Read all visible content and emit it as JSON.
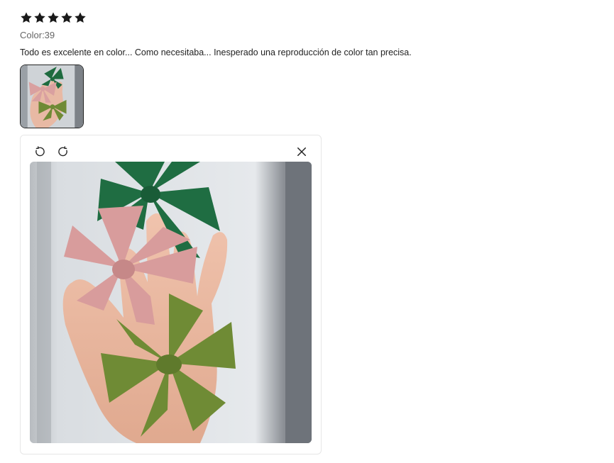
{
  "review": {
    "rating": 5,
    "rating_max": 5,
    "sku_info": "Color:39",
    "text": "Todo es excelente en color... Como necesitaba... Inesperado una reproducción de color tan precisa.",
    "star_color": "#191919"
  },
  "gallery": {
    "thumbnails": [
      {
        "icon": "review-photo-thumbnail"
      }
    ]
  },
  "viewer": {
    "controls": [
      {
        "icon": "rotate-left-icon"
      },
      {
        "icon": "rotate-right-icon"
      },
      {
        "icon": "close-icon"
      }
    ]
  },
  "colors": {
    "green_bow": "#1e6b3f",
    "pink_bow": "#d9a0a0",
    "olive_bow": "#6f8a35",
    "background": "#d7dade"
  }
}
